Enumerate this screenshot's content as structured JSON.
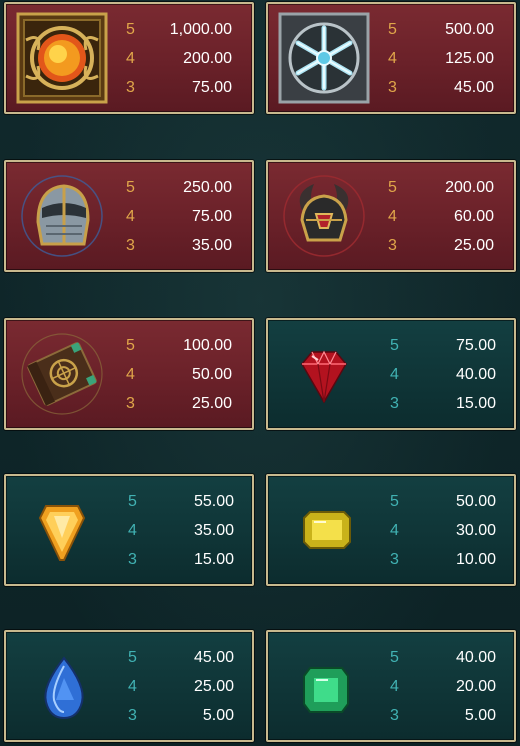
{
  "paytable": [
    {
      "symbol": "sun-amulet-icon",
      "theme": "red",
      "rows": [
        {
          "count": "5",
          "value": "1,000.00"
        },
        {
          "count": "4",
          "value": "200.00"
        },
        {
          "count": "3",
          "value": "75.00"
        }
      ]
    },
    {
      "symbol": "snowflake-icon",
      "theme": "red",
      "rows": [
        {
          "count": "5",
          "value": "500.00"
        },
        {
          "count": "4",
          "value": "125.00"
        },
        {
          "count": "3",
          "value": "45.00"
        }
      ]
    },
    {
      "symbol": "knight-helmet-icon",
      "theme": "red",
      "rows": [
        {
          "count": "5",
          "value": "250.00"
        },
        {
          "count": "4",
          "value": "75.00"
        },
        {
          "count": "3",
          "value": "35.00"
        }
      ]
    },
    {
      "symbol": "winged-helmet-icon",
      "theme": "red",
      "rows": [
        {
          "count": "5",
          "value": "200.00"
        },
        {
          "count": "4",
          "value": "60.00"
        },
        {
          "count": "3",
          "value": "25.00"
        }
      ]
    },
    {
      "symbol": "spell-book-icon",
      "theme": "red",
      "rows": [
        {
          "count": "5",
          "value": "100.00"
        },
        {
          "count": "4",
          "value": "50.00"
        },
        {
          "count": "3",
          "value": "25.00"
        }
      ]
    },
    {
      "symbol": "red-gem-icon",
      "theme": "teal",
      "rows": [
        {
          "count": "5",
          "value": "75.00"
        },
        {
          "count": "4",
          "value": "40.00"
        },
        {
          "count": "3",
          "value": "15.00"
        }
      ]
    },
    {
      "symbol": "orange-gem-icon",
      "theme": "teal",
      "rows": [
        {
          "count": "5",
          "value": "55.00"
        },
        {
          "count": "4",
          "value": "35.00"
        },
        {
          "count": "3",
          "value": "15.00"
        }
      ]
    },
    {
      "symbol": "yellow-gem-icon",
      "theme": "teal",
      "rows": [
        {
          "count": "5",
          "value": "50.00"
        },
        {
          "count": "4",
          "value": "30.00"
        },
        {
          "count": "3",
          "value": "10.00"
        }
      ]
    },
    {
      "symbol": "blue-gem-icon",
      "theme": "teal",
      "rows": [
        {
          "count": "5",
          "value": "45.00"
        },
        {
          "count": "4",
          "value": "25.00"
        },
        {
          "count": "3",
          "value": "5.00"
        }
      ]
    },
    {
      "symbol": "green-gem-icon",
      "theme": "teal",
      "rows": [
        {
          "count": "5",
          "value": "40.00"
        },
        {
          "count": "4",
          "value": "20.00"
        },
        {
          "count": "3",
          "value": "5.00"
        }
      ]
    }
  ],
  "colors": {
    "red_panel": "#6a2129",
    "teal_panel": "#0f3436",
    "border": "#c8b98e",
    "count_red": "#e0a64a",
    "count_teal": "#41b2b3"
  }
}
